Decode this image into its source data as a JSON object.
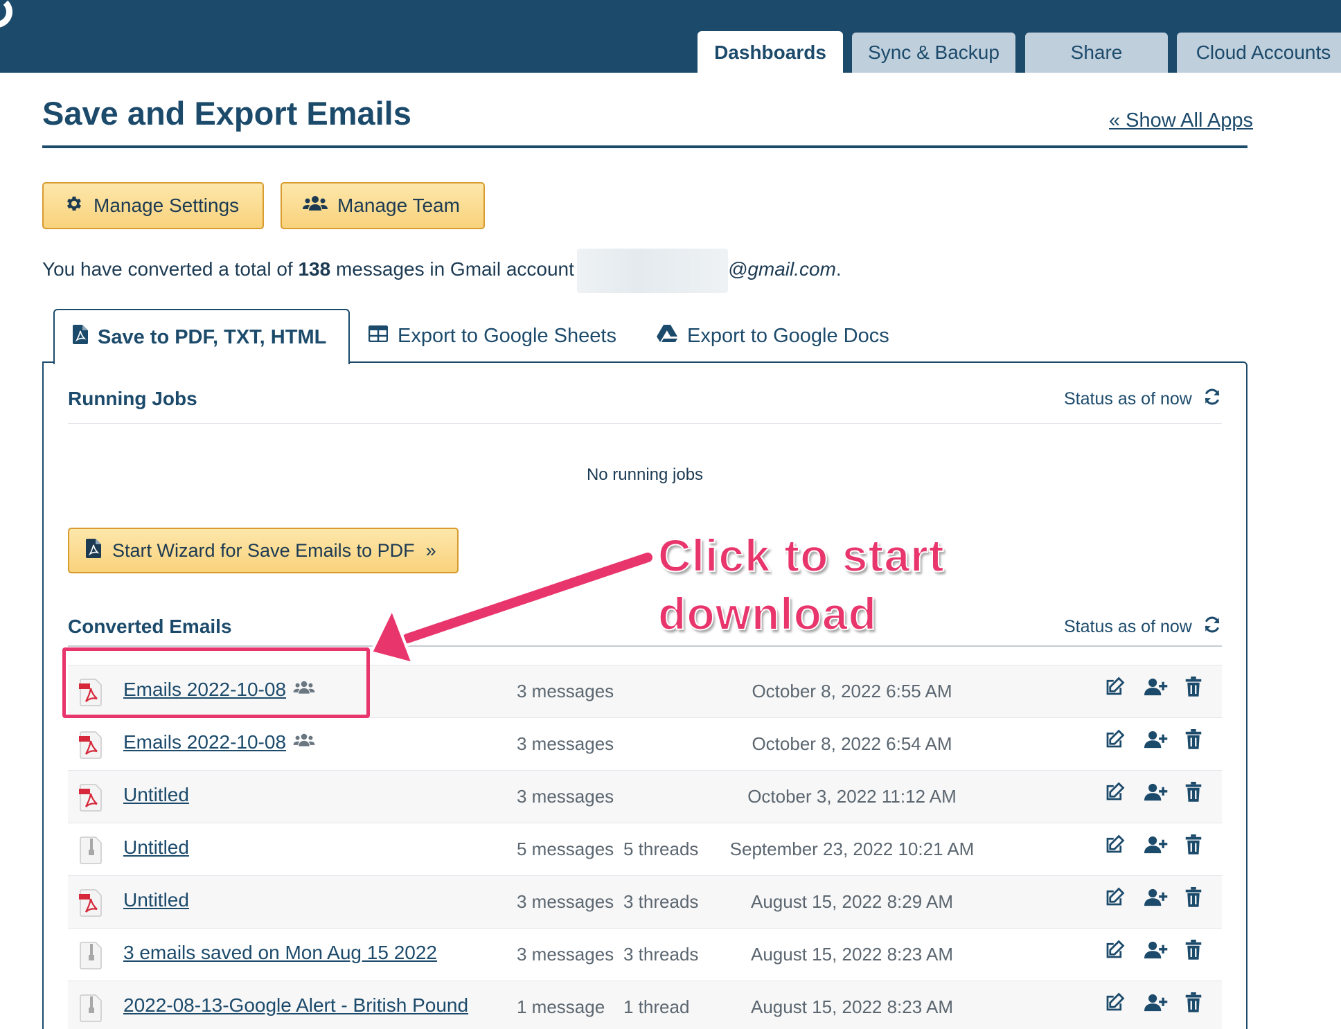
{
  "header": {
    "tabs": [
      {
        "label": "Dashboards",
        "active": true
      },
      {
        "label": "Sync & Backup",
        "active": false
      },
      {
        "label": "Share",
        "active": false
      },
      {
        "label": "Cloud Accounts",
        "active": false
      }
    ]
  },
  "page": {
    "title": "Save and Export Emails",
    "show_all_link": "« Show All Apps"
  },
  "actions": {
    "manage_settings": "Manage Settings",
    "manage_team": "Manage Team"
  },
  "summary": {
    "prefix": "You have converted a total of",
    "count": "138",
    "middle": "messages in Gmail account",
    "email_domain": "@gmail.com",
    "suffix": "."
  },
  "subtabs": [
    {
      "label": "Save to PDF, TXT, HTML",
      "active": true
    },
    {
      "label": "Export to Google Sheets",
      "active": false
    },
    {
      "label": "Export to Google Docs",
      "active": false
    }
  ],
  "running_jobs": {
    "heading": "Running Jobs",
    "status": "Status as of now",
    "empty_text": "No running jobs",
    "wizard_button": "Start Wizard for Save Emails to PDF",
    "wizard_chevron": "»"
  },
  "converted": {
    "heading": "Converted Emails",
    "status": "Status as of now",
    "rows": [
      {
        "name": "Emails 2022-10-08",
        "team": true,
        "icon": "pdf-file-icon",
        "messages": "3 messages",
        "threads": "",
        "date": "October 8, 2022 6:55 AM"
      },
      {
        "name": "Emails 2022-10-08",
        "team": true,
        "icon": "pdf-file-icon",
        "messages": "3 messages",
        "threads": "",
        "date": "October 8, 2022 6:54 AM"
      },
      {
        "name": "Untitled",
        "team": false,
        "icon": "pdf-file-icon",
        "messages": "3 messages",
        "threads": "",
        "date": "October 3, 2022 11:12 AM"
      },
      {
        "name": "Untitled",
        "team": false,
        "icon": "zip-file-icon",
        "messages": "5 messages",
        "threads": "5 threads",
        "date": "September 23, 2022 10:21 AM"
      },
      {
        "name": "Untitled",
        "team": false,
        "icon": "pdf-file-icon",
        "messages": "3 messages",
        "threads": "3 threads",
        "date": "August 15, 2022 8:29 AM"
      },
      {
        "name": "3 emails saved on Mon Aug 15 2022",
        "team": false,
        "icon": "zip-file-icon",
        "messages": "3 messages",
        "threads": "3 threads",
        "date": "August 15, 2022 8:23 AM"
      },
      {
        "name": "2022-08-13-Google Alert - British Pound",
        "team": false,
        "icon": "zip-file-icon",
        "messages": "1 message",
        "threads": "1 thread",
        "date": "August 15, 2022 8:23 AM"
      }
    ]
  },
  "annotation": {
    "line1": "Click to start",
    "line2": "download",
    "color": "#e8356c"
  },
  "colors": {
    "brand": "#1c4a6b",
    "button": "#f9d27c",
    "accent": "#e8356c"
  }
}
